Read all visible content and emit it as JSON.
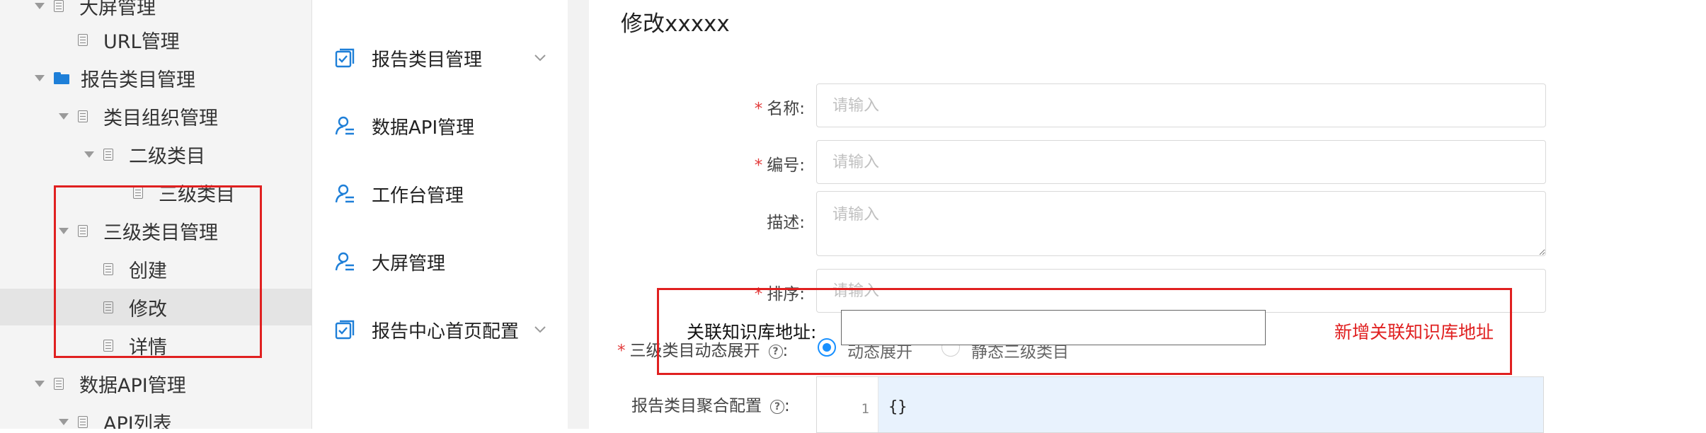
{
  "tree": {
    "items": [
      {
        "label": "大屏管理",
        "icon": "document-icon",
        "expanded": true
      },
      {
        "label": "URL管理",
        "icon": "document-icon"
      },
      {
        "label": "报告类目管理",
        "icon": "folder-icon",
        "expanded": true
      },
      {
        "label": "类目组织管理",
        "icon": "document-icon",
        "expanded": true
      },
      {
        "label": "二级类目",
        "icon": "document-icon",
        "expanded": true
      },
      {
        "label": "三级类目",
        "icon": "document-icon"
      },
      {
        "label": "三级类目管理",
        "icon": "document-icon",
        "expanded": true
      },
      {
        "label": "创建",
        "icon": "document-icon"
      },
      {
        "label": "修改",
        "icon": "document-icon",
        "selected": true
      },
      {
        "label": "详情",
        "icon": "document-icon"
      },
      {
        "label": "数据API管理",
        "icon": "document-icon",
        "expanded": true
      },
      {
        "label": "API列表",
        "icon": "document-icon",
        "expanded": true
      }
    ]
  },
  "menu": {
    "items": [
      {
        "label": "报告类目管理",
        "icon": "checklist-icon",
        "has_submenu": true
      },
      {
        "label": "数据API管理",
        "icon": "user-list-icon",
        "has_submenu": false
      },
      {
        "label": "工作台管理",
        "icon": "user-list-icon",
        "has_submenu": false
      },
      {
        "label": "大屏管理",
        "icon": "user-list-icon",
        "has_submenu": false
      },
      {
        "label": "报告中心首页配置",
        "icon": "checklist-icon",
        "has_submenu": true
      }
    ]
  },
  "form": {
    "title": "修改xxxxx",
    "required_mark": "*",
    "name": {
      "label": "名称:",
      "placeholder": "请输入"
    },
    "code": {
      "label": "编号:",
      "placeholder": "请输入"
    },
    "description": {
      "label": "描述:",
      "placeholder": "请输入"
    },
    "sort": {
      "label": "排序:",
      "placeholder": "请输入"
    },
    "expand_mode": {
      "label": "三级类目动态展开",
      "help": "?",
      "colon": ":",
      "options": [
        {
          "label": "动态展开",
          "selected": true
        },
        {
          "label": "静态三级类目",
          "selected": false
        }
      ]
    },
    "aggregate_config": {
      "label": "报告类目聚合配置",
      "help": "?",
      "colon": ":",
      "line_number": "1",
      "code": "{}"
    }
  },
  "annotation": {
    "field_label": "关联知识库地址:",
    "note": "新增关联知识库地址",
    "color": "#e02020"
  },
  "colors": {
    "accent": "#1890ff",
    "folder": "#1e7fd8",
    "required": "#e23b3b",
    "annotation": "#e02020"
  }
}
